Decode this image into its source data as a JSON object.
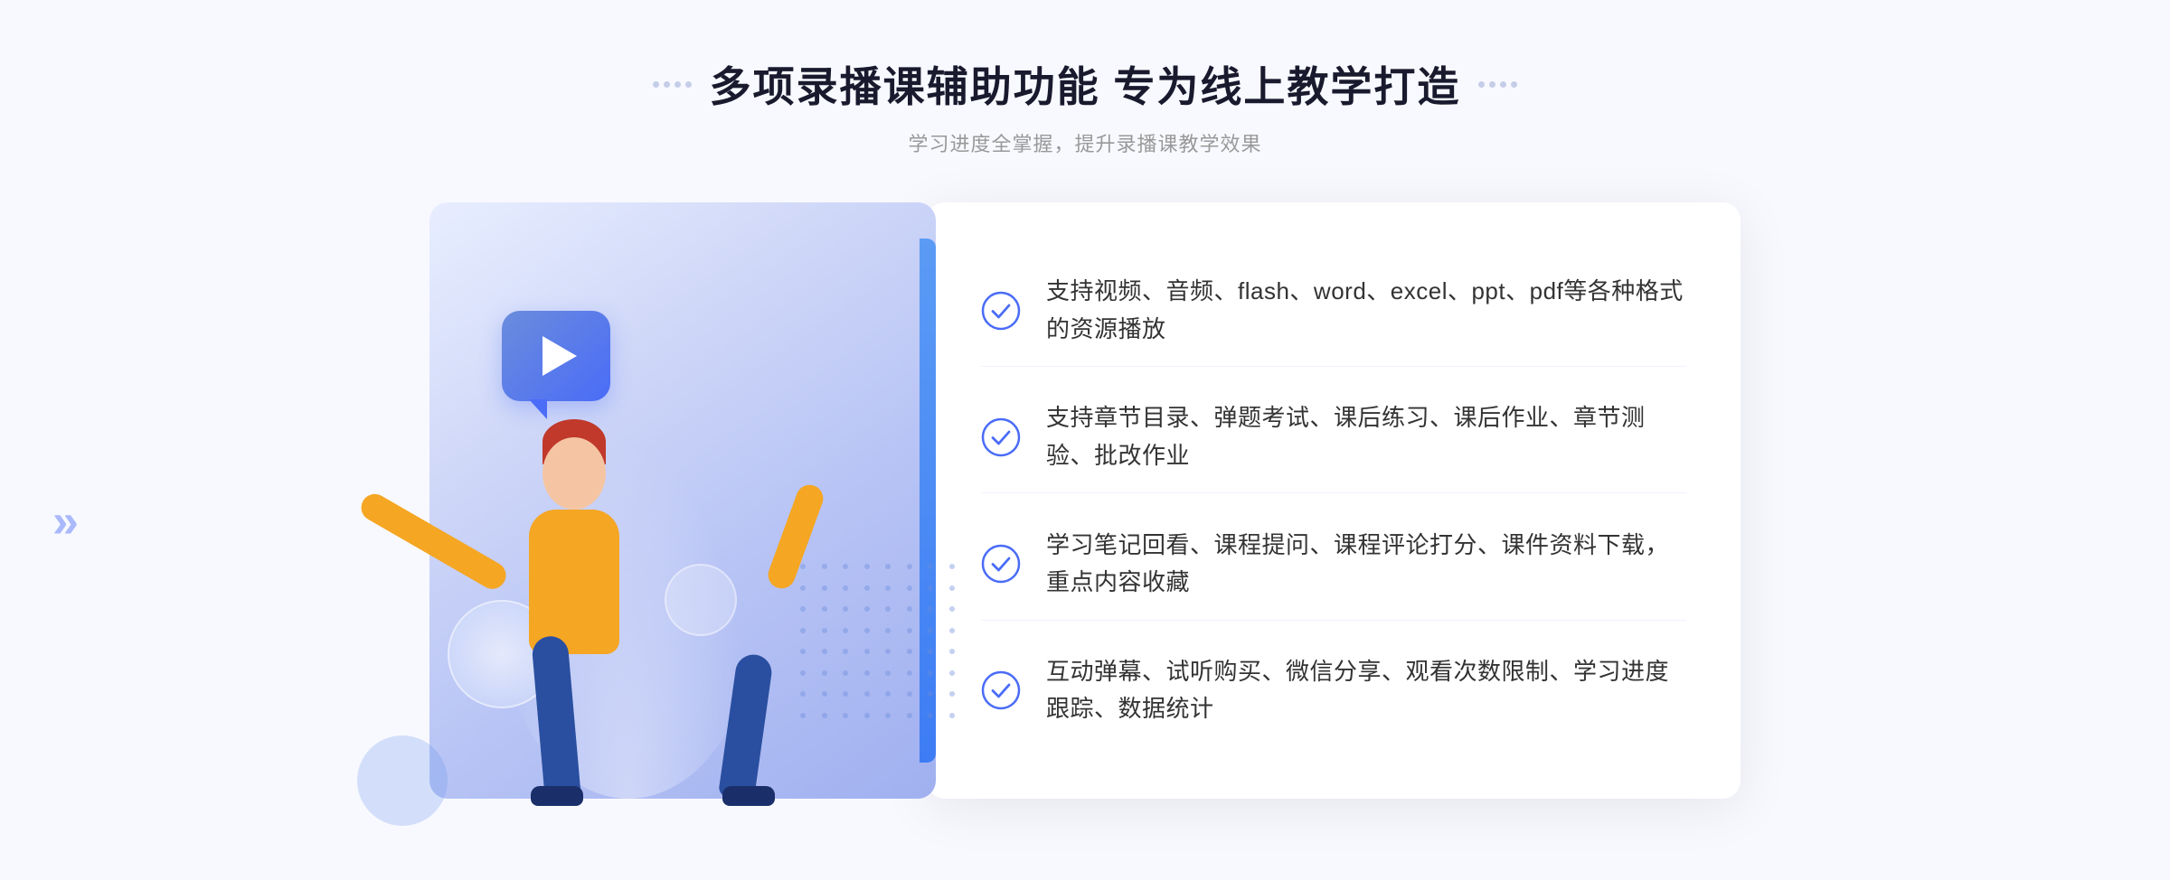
{
  "header": {
    "title": "多项录播课辅助功能 专为线上教学打造",
    "subtitle": "学习进度全掌握，提升录播课教学效果",
    "title_deco_left": "decorative-dots",
    "title_deco_right": "decorative-dots"
  },
  "features": [
    {
      "id": 1,
      "text": "支持视频、音频、flash、word、excel、ppt、pdf等各种格式的资源播放",
      "check_icon": "check-circle"
    },
    {
      "id": 2,
      "text": "支持章节目录、弹题考试、课后练习、课后作业、章节测验、批改作业",
      "check_icon": "check-circle"
    },
    {
      "id": 3,
      "text": "学习笔记回看、课程提问、课程评论打分、课件资料下载，重点内容收藏",
      "check_icon": "check-circle"
    },
    {
      "id": 4,
      "text": "互动弹幕、试听购买、微信分享、观看次数限制、学习进度跟踪、数据统计",
      "check_icon": "check-circle"
    }
  ],
  "illustration": {
    "play_button_label": "play",
    "person_label": "teacher-illustration"
  },
  "colors": {
    "primary": "#4a6cf7",
    "card_bg": "#e8eeff",
    "text_main": "#333333",
    "text_sub": "#999999",
    "title_color": "#1a1a2e"
  }
}
